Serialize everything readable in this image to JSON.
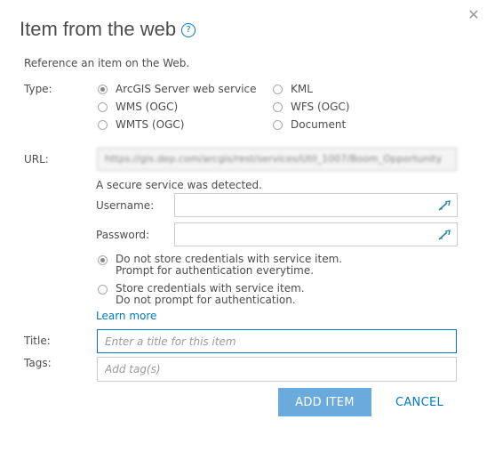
{
  "dialog": {
    "title": "Item from the web",
    "help_glyph": "?",
    "close_glyph": "✕",
    "description": "Reference an item on the Web."
  },
  "type": {
    "label": "Type:",
    "options": [
      {
        "label": "ArcGIS Server web service",
        "checked": true
      },
      {
        "label": "KML",
        "checked": false
      },
      {
        "label": "WMS (OGC)",
        "checked": false
      },
      {
        "label": "WFS (OGC)",
        "checked": false
      },
      {
        "label": "WMTS (OGC)",
        "checked": false
      },
      {
        "label": "Document",
        "checked": false
      }
    ]
  },
  "url": {
    "label": "URL:",
    "value": "https://gis.dep.com/arcgis/rest/services/Util_1007/Boom_Opportunity"
  },
  "secure": {
    "message": "A secure service was detected.",
    "username_label": "Username:",
    "password_label": "Password:",
    "options": [
      {
        "line1": "Do not store credentials with service item.",
        "line2": "Prompt for authentication everytime.",
        "checked": true
      },
      {
        "line1": "Store credentials with service item.",
        "line2": "Do not prompt for authentication.",
        "checked": false
      }
    ],
    "learn_more": "Learn more"
  },
  "title_field": {
    "label": "Title:",
    "placeholder": "Enter a title for this item"
  },
  "tags_field": {
    "label": "Tags:",
    "placeholder": "Add tag(s)"
  },
  "buttons": {
    "add": "ADD ITEM",
    "cancel": "CANCEL"
  },
  "icons": {
    "help": "help-icon",
    "close": "close-icon",
    "key": "key-icon"
  },
  "colors": {
    "accent": "#0079c1",
    "primary_button": "#6aaadc"
  }
}
